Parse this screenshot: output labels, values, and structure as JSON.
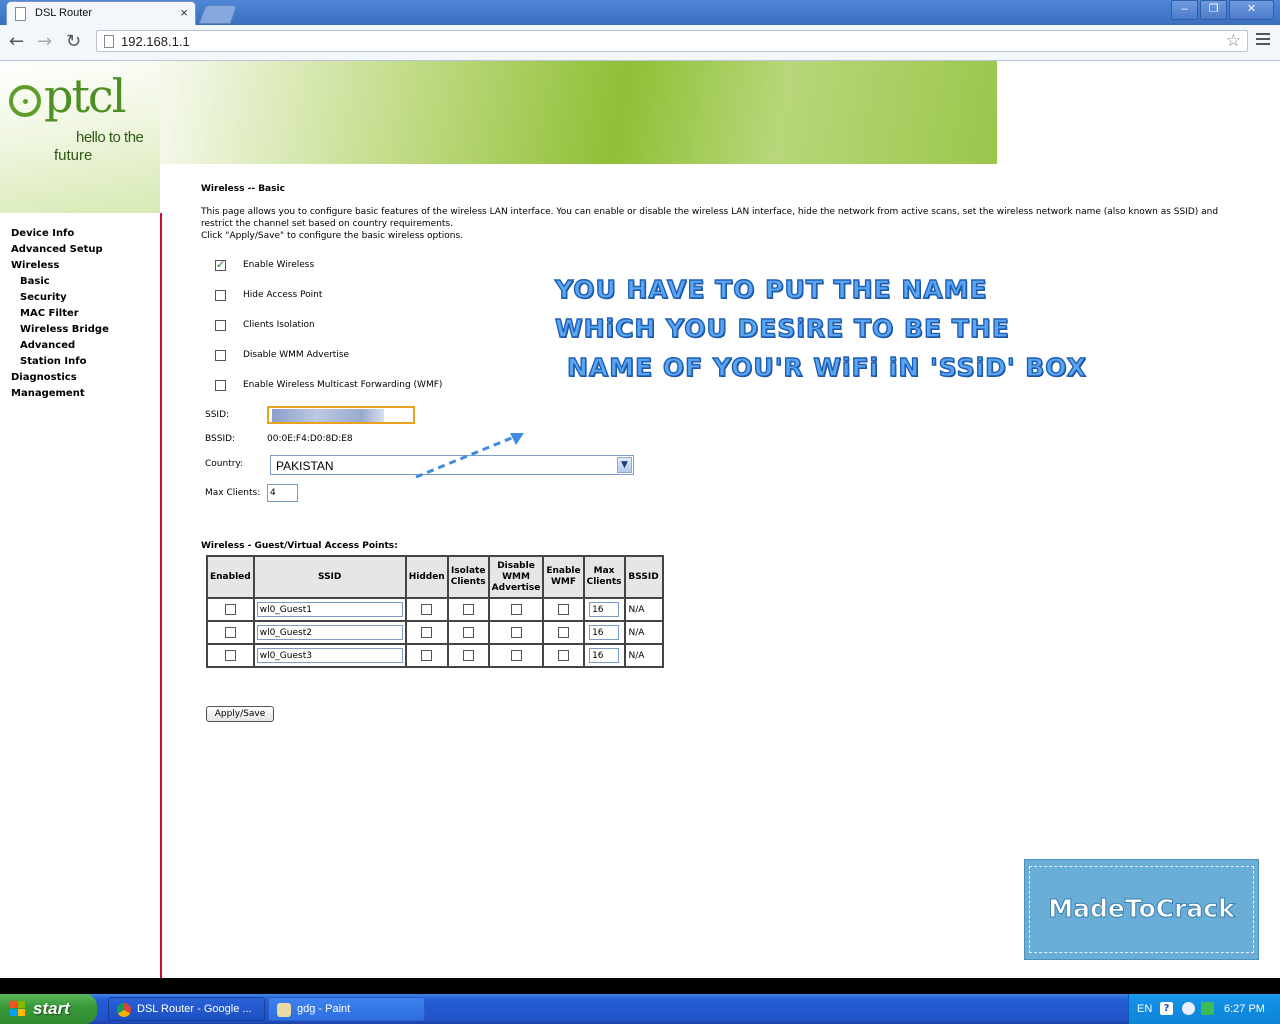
{
  "browser": {
    "tab_title": "DSL Router",
    "close_glyph": "×",
    "url": "192.168.1.1",
    "window_controls": [
      "–",
      "❐",
      "✕"
    ]
  },
  "logo": {
    "brand": "ptcl",
    "tag_line1": "hello to the",
    "tag_line2": "future"
  },
  "sidebar": {
    "items": [
      {
        "label": "Device Info"
      },
      {
        "label": "Advanced Setup"
      },
      {
        "label": "Wireless"
      },
      {
        "label": "Basic"
      },
      {
        "label": "Security"
      },
      {
        "label": "MAC Filter"
      },
      {
        "label": "Wireless Bridge"
      },
      {
        "label": "Advanced"
      },
      {
        "label": "Station Info"
      },
      {
        "label": "Diagnostics"
      },
      {
        "label": "Management"
      }
    ]
  },
  "main": {
    "heading": "Wireless -- Basic",
    "description": "This page allows you to configure basic features of the wireless LAN interface. You can enable or disable the wireless LAN interface, hide the network from active scans, set the wireless network name (also known as SSID) and restrict the channel set based on country requirements.",
    "description2": "Click \"Apply/Save\" to configure the basic wireless options.",
    "options": [
      {
        "label": "Enable Wireless",
        "checked": true
      },
      {
        "label": "Hide Access Point",
        "checked": false
      },
      {
        "label": "Clients Isolation",
        "checked": false
      },
      {
        "label": "Disable WMM Advertise",
        "checked": false
      },
      {
        "label": "Enable Wireless Multicast Forwarding (WMF)",
        "checked": false
      }
    ],
    "ssid_label": "SSID:",
    "bssid_label": "BSSID:",
    "bssid_value": "00:0E:F4:D0:8D:E8",
    "country_label": "Country:",
    "country_value": "PAKISTAN",
    "max_clients_label": "Max Clients:",
    "max_clients_value": "4",
    "guest_title": "Wireless - Guest/Virtual Access Points:",
    "guest_headers": [
      "Enabled",
      "SSID",
      "Hidden",
      "Isolate Clients",
      "Disable WMM Advertise",
      "Enable WMF",
      "Max Clients",
      "BSSID"
    ],
    "guest_rows": [
      {
        "ssid": "wl0_Guest1",
        "max": "16",
        "bssid": "N/A"
      },
      {
        "ssid": "wl0_Guest2",
        "max": "16",
        "bssid": "N/A"
      },
      {
        "ssid": "wl0_Guest3",
        "max": "16",
        "bssid": "N/A"
      }
    ],
    "apply_label": "Apply/Save"
  },
  "annotation": {
    "line1": "YOU HAVE TO PUT THE NAME",
    "line2": "WHiCH YOU DESiRE TO BE THE",
    "line3": "NAME OF YOU'R WiFi iN 'SSiD' BOX",
    "color": "#5aa6f2",
    "watermark": "MadeToCrack"
  },
  "taskbar": {
    "start": "start",
    "tasks": [
      {
        "label": "DSL Router - Google ..."
      },
      {
        "label": "gdg - Paint"
      }
    ],
    "lang": "EN",
    "time": "6:27 PM"
  }
}
